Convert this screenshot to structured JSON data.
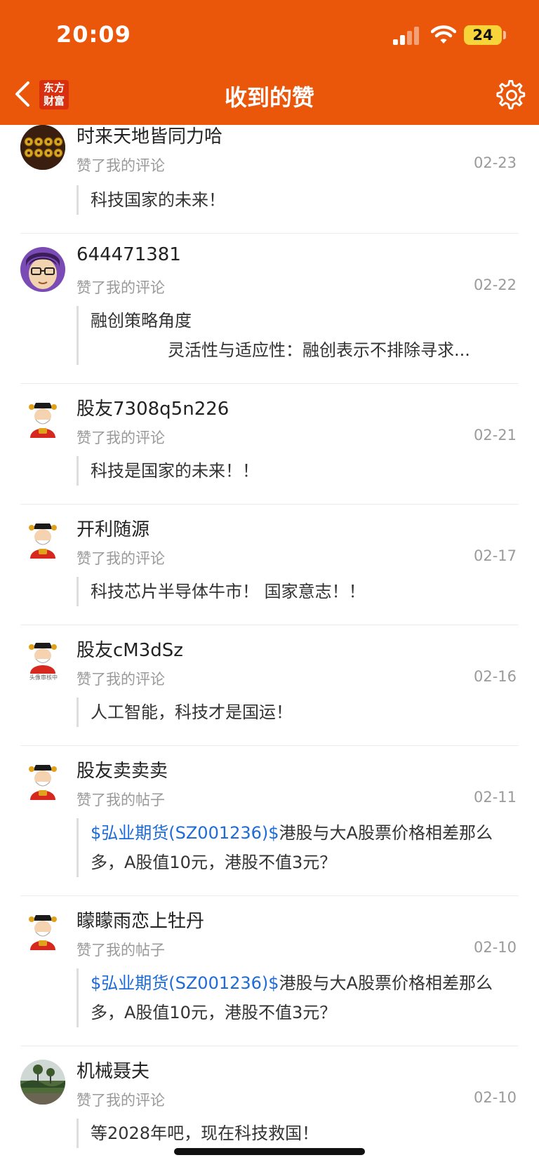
{
  "status": {
    "time": "20:09",
    "battery": "24"
  },
  "header": {
    "title": "收到的赞",
    "logo_line1": "东方",
    "logo_line2": "财富"
  },
  "items": [
    {
      "name": "时来天地皆同力哈",
      "action": "赞了我的评论",
      "date": "02-23",
      "content": "科技国家的未来！"
    },
    {
      "name": "644471381",
      "action": "赞了我的评论",
      "date": "02-22",
      "content": "融创策略角度",
      "content2": "灵活性与适应性：融创表示不排除寻求..."
    },
    {
      "name": "股友7308q5n226",
      "action": "赞了我的评论",
      "date": "02-21",
      "content": "科技是国家的未来！！"
    },
    {
      "name": "开利随源",
      "action": "赞了我的评论",
      "date": "02-17",
      "content": "科技芯片半导体牛市！ 国家意志！！"
    },
    {
      "name": "股友cM3dSz",
      "action": "赞了我的评论",
      "date": "02-16",
      "content": "人工智能，科技才是国运！",
      "avatar_caption": "头像审核中"
    },
    {
      "name": "股友卖卖卖",
      "action": "赞了我的帖子",
      "date": "02-11",
      "stock": "$弘业期货(SZ001236)$",
      "content": "港股与大A股票价格相差那么多，A股值10元，港股不值3元？"
    },
    {
      "name": "矇矇雨恋上牡丹",
      "action": "赞了我的帖子",
      "date": "02-10",
      "stock": "$弘业期货(SZ001236)$",
      "content": "港股与大A股票价格相差那么多，A股值10元，港股不值3元？"
    },
    {
      "name": "机械聂夫",
      "action": "赞了我的评论",
      "date": "02-10",
      "content": "等2028年吧，现在科技救国！"
    }
  ]
}
